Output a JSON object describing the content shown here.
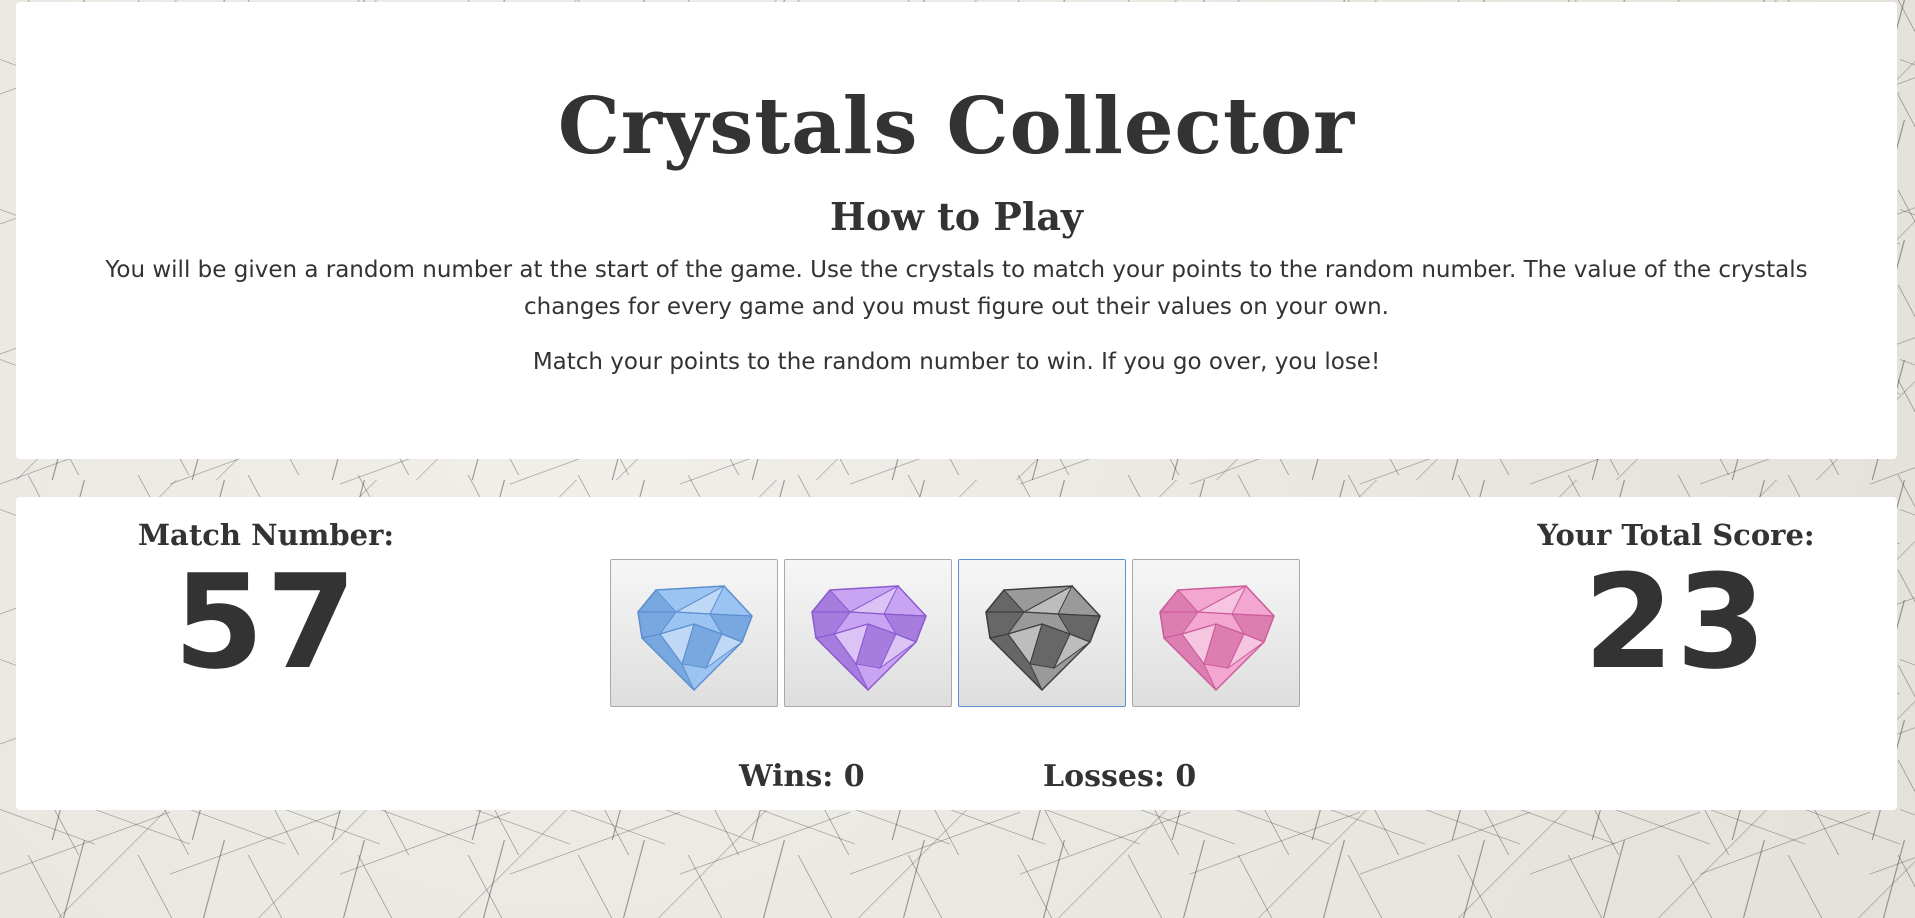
{
  "header": {
    "title": "Crystals Collector",
    "subtitle": "How to Play",
    "instructions": "You will be given a random number at the start of the game. Use the crystals to match your points to the random number. The value of the crystals changes for every game and you must figure out their values on your own.",
    "rule": "Match your points to the random number to win. If you go over, you lose!"
  },
  "game": {
    "match_label": "Match Number:",
    "match_number": "57",
    "score_label": "Your Total Score:",
    "score_number": "23",
    "wins_label": "Wins: 0",
    "losses_label": "Losses: 0",
    "crystals": [
      {
        "icon": "blue-crystal-icon",
        "color": "#9cc4f2",
        "shade": "#5c8fd0"
      },
      {
        "icon": "purple-crystal-icon",
        "color": "#c9a4f2",
        "shade": "#8a5bd0"
      },
      {
        "icon": "gray-crystal-icon",
        "color": "#9a9a9a",
        "shade": "#3e3e3e"
      },
      {
        "icon": "pink-crystal-icon",
        "color": "#f2a6d0",
        "shade": "#cc5c9a"
      }
    ]
  },
  "colors": {
    "text": "#333333",
    "panel": "#ffffff",
    "focus_border": "#5b8fd6"
  }
}
